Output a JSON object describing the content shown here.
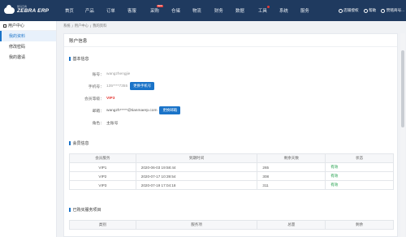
{
  "logo": {
    "brand": "ZEBRA ERP",
    "tag": "斑马云商"
  },
  "nav": [
    {
      "label": "首页",
      "badge": "",
      "dot": false
    },
    {
      "label": "产品",
      "badge": "",
      "dot": false
    },
    {
      "label": "订单",
      "badge": "",
      "dot": false
    },
    {
      "label": "客服",
      "badge": "",
      "dot": false
    },
    {
      "label": "采购",
      "badge": "NEW",
      "dot": false
    },
    {
      "label": "仓储",
      "badge": "",
      "dot": false
    },
    {
      "label": "物流",
      "badge": "",
      "dot": false
    },
    {
      "label": "财务",
      "badge": "",
      "dot": false
    },
    {
      "label": "数据",
      "badge": "",
      "dot": false
    },
    {
      "label": "工具",
      "badge": "",
      "dot": true
    },
    {
      "label": "系统",
      "badge": "",
      "dot": false
    },
    {
      "label": "服务",
      "badge": "",
      "dot": false
    }
  ],
  "right_nav": {
    "store": "店铺授权",
    "help": "帮助",
    "user": "赞铭商号..."
  },
  "sidebar": {
    "header": "用户中心",
    "items": [
      "我的资料",
      "修改密码",
      "我的邀请"
    ]
  },
  "breadcrumb": [
    "系统",
    "/",
    "用户中心",
    "/",
    "我的资料"
  ],
  "panel_title": "账户信息",
  "basic": {
    "section": "基本信息",
    "account_label": "账号：",
    "account_value": "wangzhengjie",
    "phone_label": "手机号：",
    "phone_value": "135****7355",
    "phone_btn": "更换手机号",
    "level_label": "会员等级：",
    "level_value": "VIP3",
    "email_label": "邮箱：",
    "email_value": "wangzh*****@tianmaerp.com",
    "email_btn": "更换邮箱",
    "role_label": "角色：",
    "role_value": "主账号"
  },
  "member": {
    "section": "会员信息",
    "headers": [
      "会员服务",
      "到期时间",
      "剩余天数",
      "状态"
    ],
    "rows": [
      [
        "VIP1",
        "2020-06-03 19:58:44",
        "265",
        "有效"
      ],
      [
        "VIP2",
        "2020-07-17 10:39:54",
        "308",
        "有效"
      ],
      [
        "VIP3",
        "2020-07-19 17:04:18",
        "311",
        "有效"
      ]
    ]
  },
  "purchased": {
    "section": "已购买服务项目",
    "headers": [
      "类别",
      "服务项",
      "总量",
      "剩余"
    ]
  },
  "colors": {
    "topbar": "#1f3a5f",
    "accent": "#1a73c8",
    "ok": "#1e9e4a",
    "vip": "#e53935"
  }
}
